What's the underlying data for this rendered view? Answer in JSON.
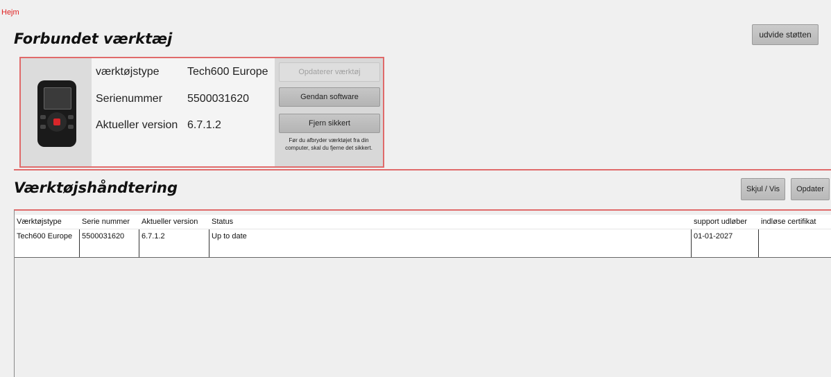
{
  "nav": {
    "home_label": "Hejm"
  },
  "connected": {
    "title": "Forbundet værktæj",
    "info": [
      {
        "label": "værktøjstype",
        "value": "Tech600 Europe"
      },
      {
        "label": "Serienummer",
        "value": "5500031620"
      },
      {
        "label": "Aktueller version",
        "value": "6.7.1.2"
      }
    ],
    "actions": {
      "update_label": "Opdaterer værktøj",
      "restore_label": "Gendan software",
      "eject_label": "Fjern sikkert",
      "eject_hint": "Før du afbryder værktøjet fra din computer, skal du fjerne det sikkert."
    }
  },
  "management": {
    "title": "Værktøjshåndtering",
    "toggle_label": "Skjul / Vis",
    "refresh_label": "Opdater",
    "columns": [
      "Værktøjstype",
      "Serie nummer",
      "Aktueller version",
      "Status",
      "support udløber",
      "indløse certifikat"
    ],
    "rows": [
      {
        "tool_type": "Tech600 Europe",
        "serial": "5500031620",
        "version": "6.7.1.2",
        "status": "Up to date",
        "support_expires": "01-01-2027",
        "action_label": "udvide støtten"
      }
    ]
  }
}
